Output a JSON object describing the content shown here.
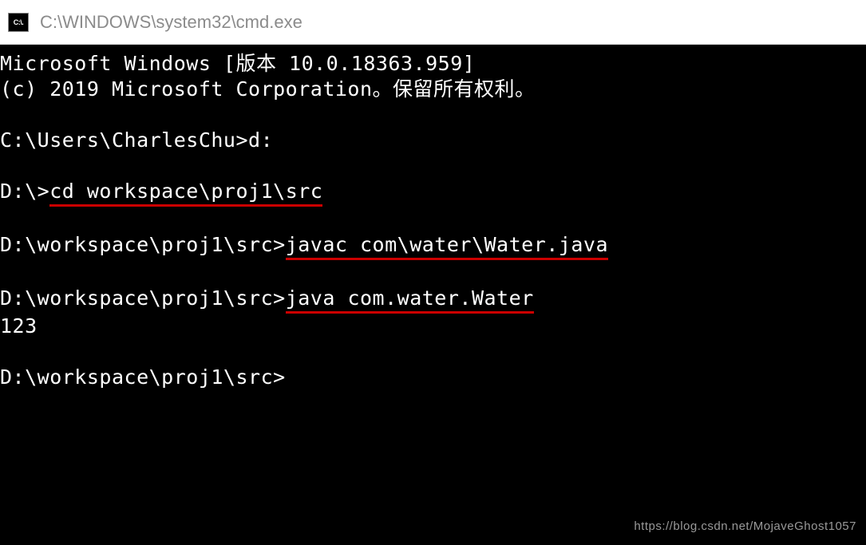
{
  "titlebar": {
    "icon_text": "C:\\.",
    "title": "C:\\WINDOWS\\system32\\cmd.exe"
  },
  "terminal": {
    "line1": "Microsoft Windows [版本 10.0.18363.959]",
    "line2": "(c) 2019 Microsoft Corporation。保留所有权利。",
    "prompt1": "C:\\Users\\CharlesChu>",
    "cmd1": "d:",
    "prompt2": "D:\\>",
    "cmd2": "cd workspace\\proj1\\src",
    "prompt3": "D:\\workspace\\proj1\\src>",
    "cmd3": "javac com\\water\\Water.java",
    "prompt4": "D:\\workspace\\proj1\\src>",
    "cmd4": "java com.water.Water",
    "output1": "123",
    "prompt5": "D:\\workspace\\proj1\\src>"
  },
  "watermark": "https://blog.csdn.net/MojaveGhost1057"
}
